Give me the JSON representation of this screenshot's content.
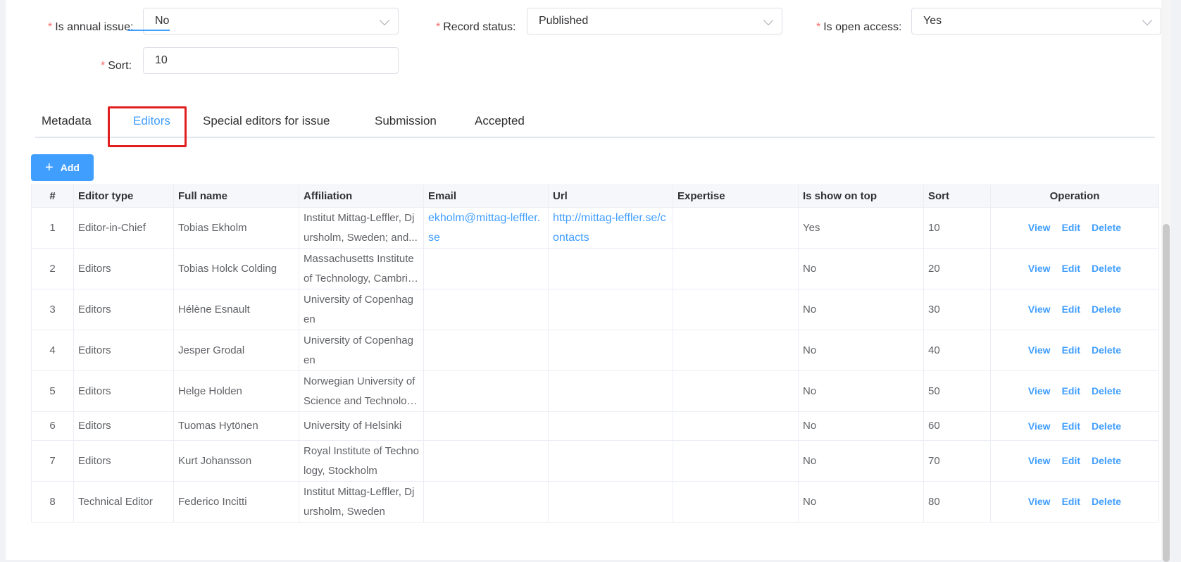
{
  "form": {
    "annual_issue": {
      "label": "Is annual issue:",
      "value": "No"
    },
    "record_status": {
      "label": "Record status:",
      "value": "Published"
    },
    "open_access": {
      "label": "Is open access:",
      "value": "Yes"
    },
    "sort": {
      "label": "Sort:",
      "value": "10"
    },
    "required_mark": "*"
  },
  "tabs": [
    {
      "label": "Metadata"
    },
    {
      "label": "Editors"
    },
    {
      "label": "Special editors for issue"
    },
    {
      "label": "Submission"
    },
    {
      "label": "Accepted"
    }
  ],
  "add_button": {
    "label": "Add",
    "icon": "+"
  },
  "table": {
    "headers": {
      "index": "#",
      "editor_type": "Editor type",
      "full_name": "Full name",
      "affiliation": "Affiliation",
      "email": "Email",
      "url": "Url",
      "expertise": "Expertise",
      "show_on_top": "Is show on top",
      "sort": "Sort",
      "operation": "Operation"
    },
    "actions": {
      "view": "View",
      "edit": "Edit",
      "delete": "Delete"
    },
    "rows": [
      {
        "index": "1",
        "editor_type": "Editor-in-Chief",
        "full_name": "Tobias Ekholm",
        "affiliation": "Institut Mittag-Leffler, Djursholm, Sweden; and...",
        "email": "ekholm@mittag-leffler.se",
        "url": "http://mittag-leffler.se/contacts",
        "expertise": "",
        "show_on_top": "Yes",
        "sort": "10"
      },
      {
        "index": "2",
        "editor_type": "Editors",
        "full_name": "Tobias Holck Colding",
        "affiliation": "Massachusetts Institute of Technology, Cambridge...",
        "email": "",
        "url": "",
        "expertise": "",
        "show_on_top": "No",
        "sort": "20"
      },
      {
        "index": "3",
        "editor_type": "Editors",
        "full_name": "Hélène Esnault",
        "affiliation": "University of Copenhagen",
        "email": "",
        "url": "",
        "expertise": "",
        "show_on_top": "No",
        "sort": "30"
      },
      {
        "index": "4",
        "editor_type": "Editors",
        "full_name": "Jesper Grodal",
        "affiliation": "University of Copenhagen",
        "email": "",
        "url": "",
        "expertise": "",
        "show_on_top": "No",
        "sort": "40"
      },
      {
        "index": "5",
        "editor_type": "Editors",
        "full_name": "Helge Holden",
        "affiliation": "Norwegian University of Science and Technology...",
        "email": "",
        "url": "",
        "expertise": "",
        "show_on_top": "No",
        "sort": "50"
      },
      {
        "index": "6",
        "editor_type": "Editors",
        "full_name": "Tuomas Hytönen",
        "affiliation": "University of Helsinki",
        "email": "",
        "url": "",
        "expertise": "",
        "show_on_top": "No",
        "sort": "60"
      },
      {
        "index": "7",
        "editor_type": "Editors",
        "full_name": "Kurt Johansson",
        "affiliation": "Royal Institute of Technology, Stockholm",
        "email": "",
        "url": "",
        "expertise": "",
        "show_on_top": "No",
        "sort": "70"
      },
      {
        "index": "8",
        "editor_type": "Technical Editor",
        "full_name": "Federico Incitti",
        "affiliation": "Institut Mittag-Leffler, Djursholm, Sweden",
        "email": "",
        "url": "",
        "expertise": "",
        "show_on_top": "No",
        "sort": "80"
      }
    ]
  },
  "colors": {
    "accent": "#409eff",
    "required": "#f56c6c",
    "highlight": "#e02020"
  }
}
